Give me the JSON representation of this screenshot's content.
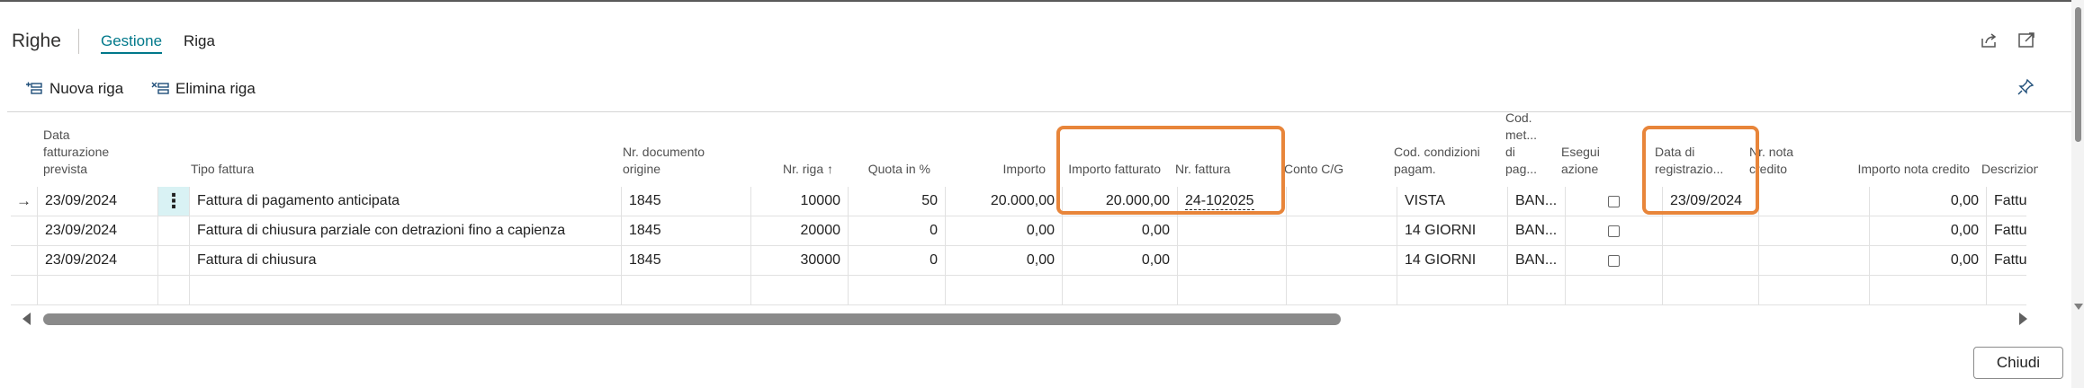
{
  "header": {
    "title": "Righe",
    "tabs": [
      {
        "label": "Gestione",
        "active": true
      },
      {
        "label": "Riga",
        "active": false
      }
    ],
    "icons": [
      "share-icon",
      "expand-icon"
    ]
  },
  "actions": {
    "new_line": "Nuova riga",
    "delete_line": "Elimina riga",
    "pin_icon": "pin-icon"
  },
  "grid": {
    "headers": {
      "data_fatturazione": "Data fatturazione prevista",
      "tipo_fattura": "Tipo fattura",
      "nr_documento": "Nr. documento origine",
      "nr_riga": "Nr. riga ↑",
      "quota": "Quota in %",
      "importo": "Importo",
      "importo_fatturato": "Importo fatturato",
      "nr_fattura": "Nr. fattura",
      "conto": "Conto C/G",
      "cod_condizioni": "Cod. condizioni pagam.",
      "cod_metodo": "Cod. met... di pag...",
      "esegui": "Esegui azione",
      "data_registrazione": "Data di registrazio...",
      "nr_nota": "Nr. nota credito",
      "importo_nota": "Importo nota credito",
      "descrizione": "Descrizione"
    },
    "rows": [
      {
        "data": "23/09/2024",
        "tipo": "Fattura di pagamento anticipata",
        "doc": "1845",
        "riga": "10000",
        "quota": "50",
        "importo": "20.000,00",
        "fatturato": "20.000,00",
        "nr_fattura": "24-102025",
        "conto": "",
        "cond": "VISTA",
        "metodo": "BAN...",
        "esegui": false,
        "data_reg": "23/09/2024",
        "nota": "",
        "importo_nota": "0,00",
        "descr": "Fattura di"
      },
      {
        "data": "23/09/2024",
        "tipo": "Fattura di chiusura parziale con detrazioni fino a capienza",
        "doc": "1845",
        "riga": "20000",
        "quota": "0",
        "importo": "0,00",
        "fatturato": "0,00",
        "nr_fattura": "",
        "conto": "",
        "cond": "14 GIORNI",
        "metodo": "BAN...",
        "esegui": false,
        "data_reg": "",
        "nota": "",
        "importo_nota": "0,00",
        "descr": "Fattura di"
      },
      {
        "data": "23/09/2024",
        "tipo": "Fattura di chiusura",
        "doc": "1845",
        "riga": "30000",
        "quota": "0",
        "importo": "0,00",
        "fatturato": "0,00",
        "nr_fattura": "",
        "conto": "",
        "cond": "14 GIORNI",
        "metodo": "BAN...",
        "esegui": false,
        "data_reg": "",
        "nota": "",
        "importo_nota": "0,00",
        "descr": "Fattura di"
      }
    ]
  },
  "highlight_color": "#e8853a",
  "accent_color": "#00788a",
  "footer": {
    "close": "Chiudi"
  }
}
